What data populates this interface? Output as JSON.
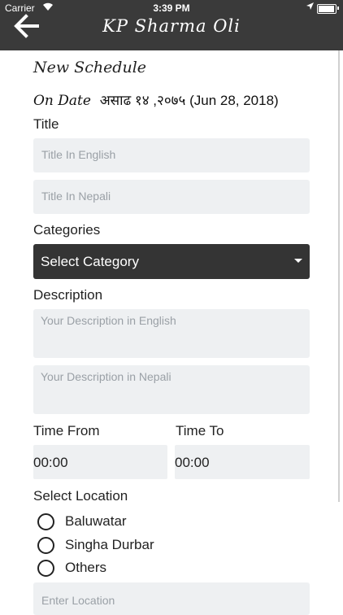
{
  "status_bar": {
    "carrier": "Carrier",
    "time": "3:39 PM"
  },
  "header": {
    "title": "KP Sharma Oli"
  },
  "form": {
    "heading": "New Schedule",
    "date_label": "On Date",
    "date_value": "असाढ १४ ,२०७५ (Jun 28, 2018)",
    "title_label": "Title",
    "title_en_placeholder": "Title In English",
    "title_np_placeholder": "Title In Nepali",
    "categories_label": "Categories",
    "category_select": "Select Category",
    "description_label": "Description",
    "desc_en_placeholder": "Your Description in English",
    "desc_np_placeholder": "Your Description in Nepali",
    "time_from_label": "Time From",
    "time_to_label": "Time To",
    "time_from_value": "00:00",
    "time_to_value": "00:00",
    "location_label": "Select Location",
    "locations": [
      "Baluwatar",
      "Singha Durbar",
      "Others"
    ],
    "location_placeholder": "Enter Location"
  }
}
